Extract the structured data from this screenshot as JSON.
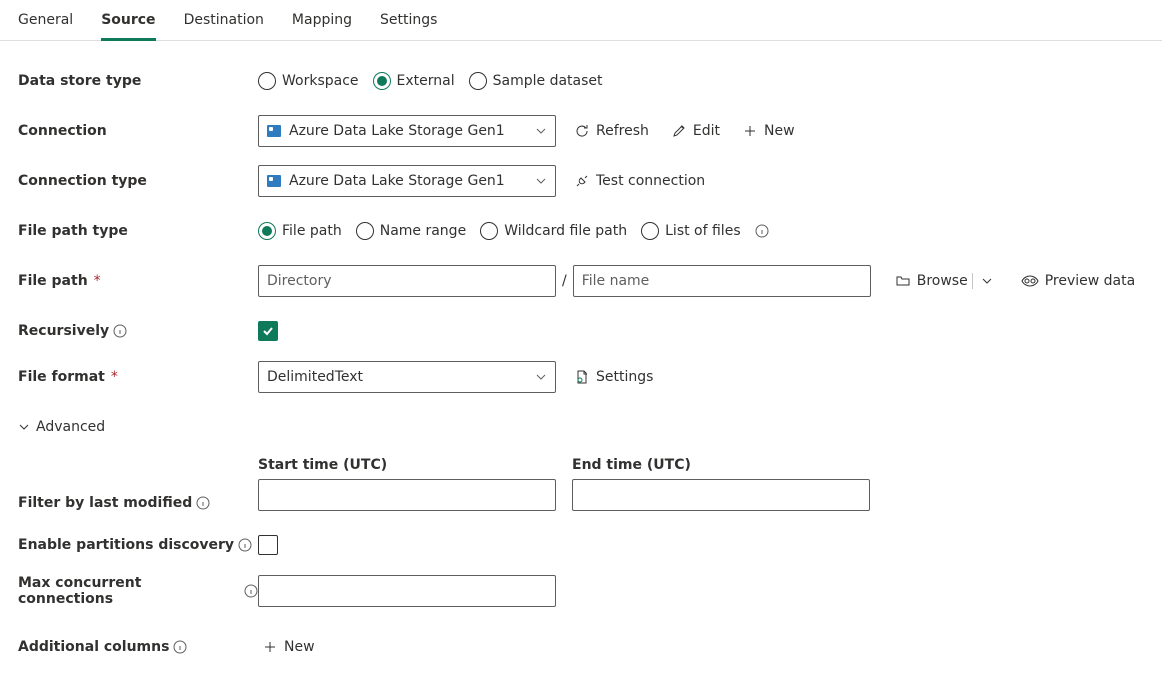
{
  "tabs": {
    "general": "General",
    "source": "Source",
    "destination": "Destination",
    "mapping": "Mapping",
    "settings": "Settings",
    "active": "source"
  },
  "labels": {
    "data_store_type": "Data store type",
    "connection": "Connection",
    "connection_type": "Connection type",
    "file_path_type": "File path type",
    "file_path": "File path",
    "recursively": "Recursively",
    "file_format": "File format",
    "advanced": "Advanced",
    "filter_by_last_modified": "Filter by last modified",
    "start_time": "Start time (UTC)",
    "end_time": "End time (UTC)",
    "enable_partitions": "Enable partitions discovery",
    "max_concurrent": "Max concurrent connections",
    "additional_columns": "Additional columns"
  },
  "data_store_type": {
    "options": {
      "workspace": "Workspace",
      "external": "External",
      "sample": "Sample dataset"
    },
    "selected": "external"
  },
  "connection": {
    "value": "Azure Data Lake Storage Gen1",
    "actions": {
      "refresh": "Refresh",
      "edit": "Edit",
      "new": "New"
    }
  },
  "connection_type": {
    "value": "Azure Data Lake Storage Gen1",
    "actions": {
      "test": "Test connection"
    }
  },
  "file_path_type": {
    "options": {
      "file_path": "File path",
      "name_range": "Name range",
      "wildcard": "Wildcard file path",
      "list": "List of files"
    },
    "selected": "file_path"
  },
  "file_path": {
    "dir_placeholder": "Directory",
    "file_placeholder": "File name",
    "dir_value": "",
    "file_value": "",
    "browse": "Browse",
    "preview": "Preview data"
  },
  "recursively": {
    "checked": true
  },
  "file_format": {
    "value": "DelimitedText",
    "settings_label": "Settings"
  },
  "filter": {
    "start_value": "",
    "end_value": ""
  },
  "enable_partitions": {
    "checked": false
  },
  "max_concurrent": {
    "value": ""
  },
  "additional_columns": {
    "new_label": "New"
  }
}
